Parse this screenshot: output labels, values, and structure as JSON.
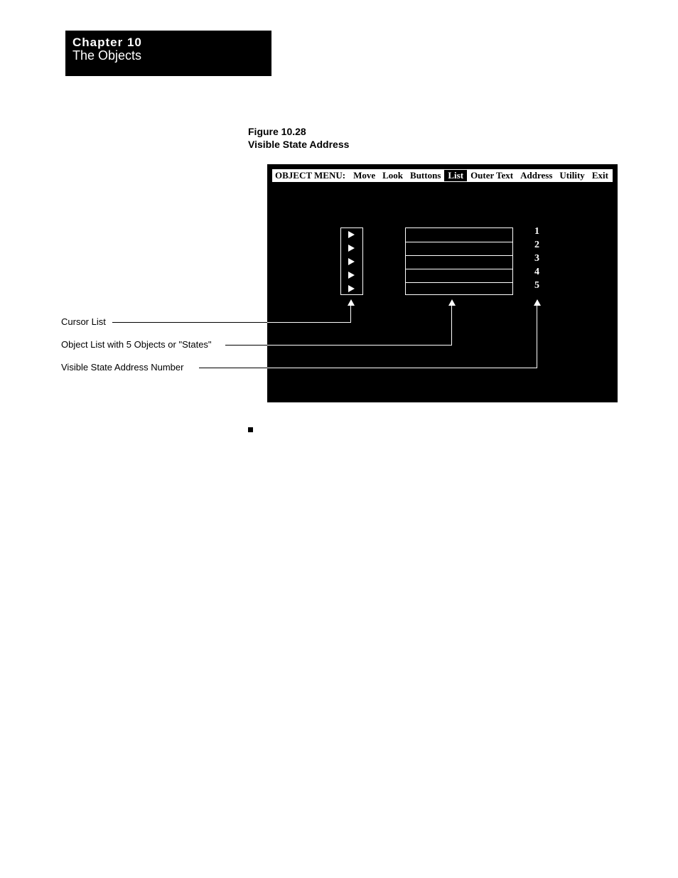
{
  "chapter": {
    "number_label": "Chapter  10",
    "title": "The Objects"
  },
  "figure": {
    "caption_line1": "Figure 10.28",
    "caption_line2": "Visible State Address"
  },
  "menu": {
    "label": "OBJECT MENU:",
    "items": [
      {
        "text": "Move",
        "highlighted": false
      },
      {
        "text": "Look",
        "highlighted": false
      },
      {
        "text": "Buttons",
        "highlighted": false
      },
      {
        "text": "List",
        "highlighted": true
      },
      {
        "text": "Outer Text",
        "highlighted": false
      },
      {
        "text": "Address",
        "highlighted": false
      },
      {
        "text": "Utility",
        "highlighted": false
      },
      {
        "text": "Exit",
        "highlighted": false
      }
    ]
  },
  "state_numbers": [
    "1",
    "2",
    "3",
    "4",
    "5"
  ],
  "callouts": {
    "cursor_list": "Cursor List",
    "object_list": "Object List with 5 Objects or \"States\"",
    "vsa_number": "Visible State Address Number"
  }
}
